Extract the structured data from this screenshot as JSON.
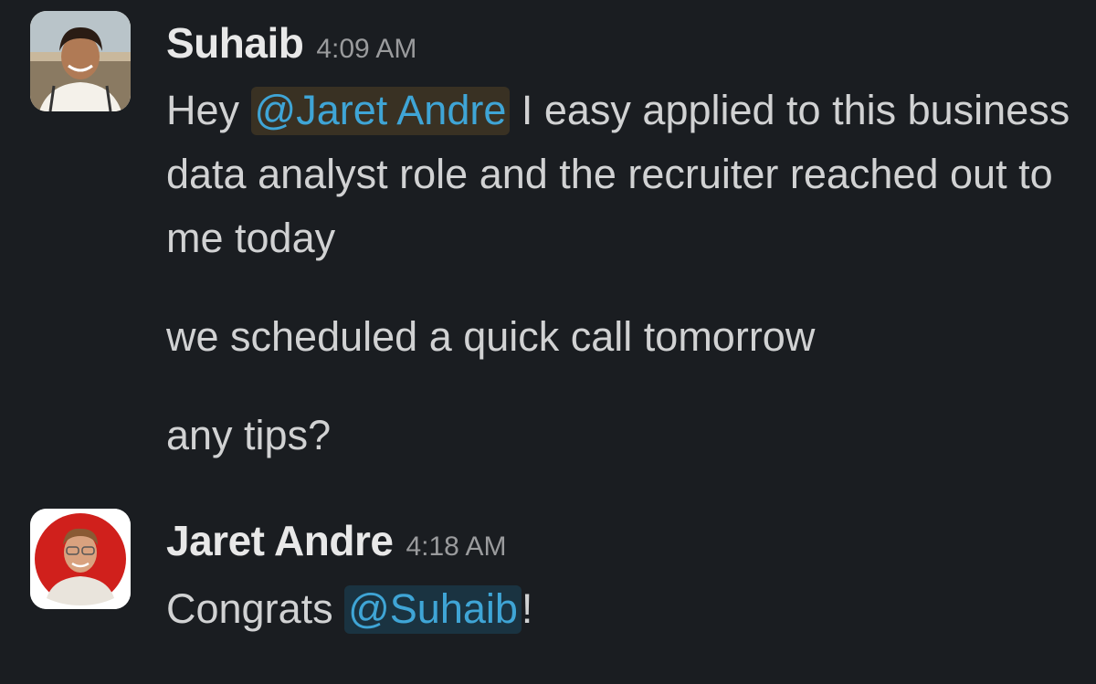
{
  "messages": [
    {
      "author": "Suhaib",
      "time": "4:09 AM",
      "avatar": "user-avatar-photo",
      "paragraphs": [
        {
          "before": "Hey ",
          "mention": "@Jaret Andre",
          "after": " I easy applied to this business data analyst role and the recruiter reached out to me today"
        },
        {
          "text": "we scheduled a quick call tomorrow"
        },
        {
          "text": "any tips?"
        }
      ]
    },
    {
      "author": "Jaret Andre",
      "time": "4:18 AM",
      "avatar": "user-avatar-photo",
      "paragraphs": [
        {
          "before": "Congrats ",
          "mention": "@Suhaib",
          "after": "!"
        }
      ]
    }
  ],
  "colors": {
    "background": "#1a1d21",
    "text": "#d1d2d3",
    "mention": "#3fa5d6",
    "mention_bg_other": "#3a3322",
    "mention_bg_self": "#183546",
    "timestamp": "#9a9b9d"
  }
}
